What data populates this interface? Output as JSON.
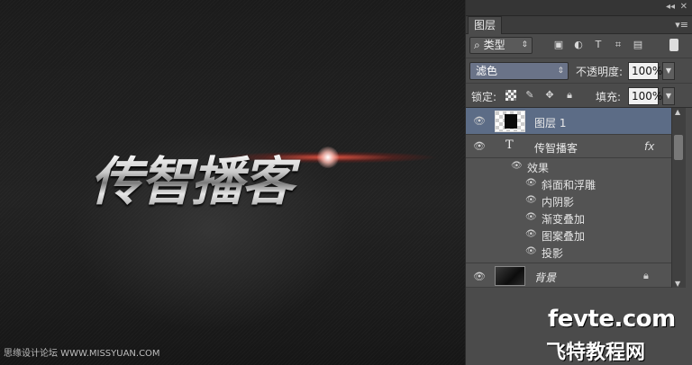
{
  "canvas": {
    "title_text": "传智播客",
    "watermark_left": "思缘设计论坛 WWW.MISSYUAN.COM"
  },
  "panel": {
    "collapse_glyph": "◂◂",
    "close_glyph": "✕",
    "tab_label": "图层",
    "menu_glyph": "▾≡",
    "filter": {
      "search_glyph": "⌕",
      "selected": "类型",
      "icons": [
        "image-filter-icon",
        "adjustment-filter-icon",
        "type-filter-icon",
        "shape-filter-icon",
        "smart-object-filter-icon"
      ]
    },
    "blend_mode": "滤色",
    "opacity_label": "不透明度:",
    "opacity_value": "100%",
    "lock_label": "锁定:",
    "fill_label": "填充:",
    "fill_value": "100%",
    "layers": {
      "layer1_name": "图层 1",
      "text_layer_name": "传智播客",
      "text_layer_type_glyph": "T",
      "fx_badge": "fx",
      "effects_label": "效果",
      "effects": [
        "斜面和浮雕",
        "内阴影",
        "渐变叠加",
        "图案叠加",
        "投影"
      ],
      "bg_name": "背景"
    }
  },
  "watermark_right": {
    "domain": "fevte.com",
    "cn": "飞特教程网"
  }
}
